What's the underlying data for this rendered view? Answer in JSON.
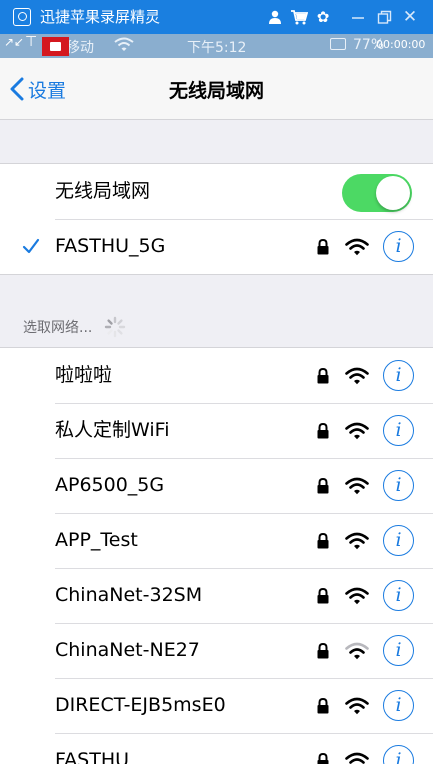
{
  "recorder": {
    "title": "迅捷苹果录屏精灵",
    "icons": [
      "user-icon",
      "cart-icon",
      "gear-icon",
      "minimize-icon",
      "restore-icon",
      "close-icon"
    ],
    "gear_glyph": "✿",
    "close_glyph": "✕",
    "timer": "00:00:00"
  },
  "status_bar": {
    "carrier": "移动",
    "time": "下午5:12",
    "battery": "77%"
  },
  "nav": {
    "back_label": "设置",
    "title": "无线局域网"
  },
  "wlan": {
    "toggle_label": "无线局域网",
    "toggle_on": true,
    "connected_network": "FASTHU_5G"
  },
  "networks_header": "选取网络...",
  "networks": [
    {
      "name": "啦啦啦",
      "secured": true,
      "signal": "strong"
    },
    {
      "name": "私人定制WiFi",
      "secured": true,
      "signal": "strong"
    },
    {
      "name": "AP6500_5G",
      "secured": true,
      "signal": "strong"
    },
    {
      "name": "APP_Test",
      "secured": true,
      "signal": "strong"
    },
    {
      "name": "ChinaNet-32SM",
      "secured": true,
      "signal": "strong"
    },
    {
      "name": "ChinaNet-NE27",
      "secured": true,
      "signal": "weak"
    },
    {
      "name": "DIRECT-EJB5msE0",
      "secured": true,
      "signal": "strong"
    },
    {
      "name": "FASTHU",
      "secured": true,
      "signal": "strong"
    }
  ],
  "info_glyph": "i",
  "colors": {
    "recorder_bar": "#1a7fe0",
    "ios_blue": "#1a7be0",
    "toggle_green": "#4cd964",
    "record_red": "#d4181f"
  }
}
